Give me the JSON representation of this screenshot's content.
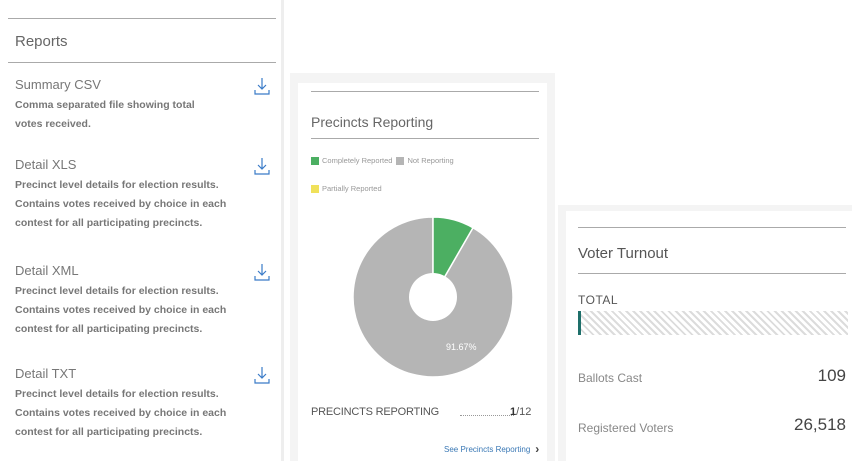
{
  "reports": {
    "title": "Reports",
    "items": [
      {
        "name": "Summary CSV",
        "desc": "Comma separated file showing total votes received."
      },
      {
        "name": "Detail XLS",
        "desc": "Precinct level details for election results. Contains votes received by choice in each contest for all participating precincts."
      },
      {
        "name": "Detail XML",
        "desc": "Precinct level details for election results. Contains votes received by choice in each contest for all participating precincts."
      },
      {
        "name": "Detail TXT",
        "desc": "Precinct level details for election results. Contains votes received by choice in each contest for all participating precincts."
      }
    ]
  },
  "precincts": {
    "title": "Precincts Reporting",
    "legend": {
      "complete": "Completely Reported",
      "not": "Not Reporting",
      "partial": "Partially Reported"
    },
    "pie_label": "91.67%",
    "reporting_label": "PRECINCTS REPORTING",
    "reported": "1",
    "total": "/12",
    "link": "See Precincts Reporting",
    "reported_fraction": 0.0833,
    "colors": {
      "complete": "#4caf62",
      "not": "#b5b5b5",
      "partial": "#f0e15a"
    }
  },
  "turnout": {
    "title": "Voter Turnout",
    "total_label": "TOTAL",
    "turnout_fraction": 0.0041,
    "ballots_label": "Ballots Cast",
    "ballots_value": "109",
    "registered_label": "Registered Voters",
    "registered_value": "26,518",
    "bar_color": "#1e6f6a"
  }
}
